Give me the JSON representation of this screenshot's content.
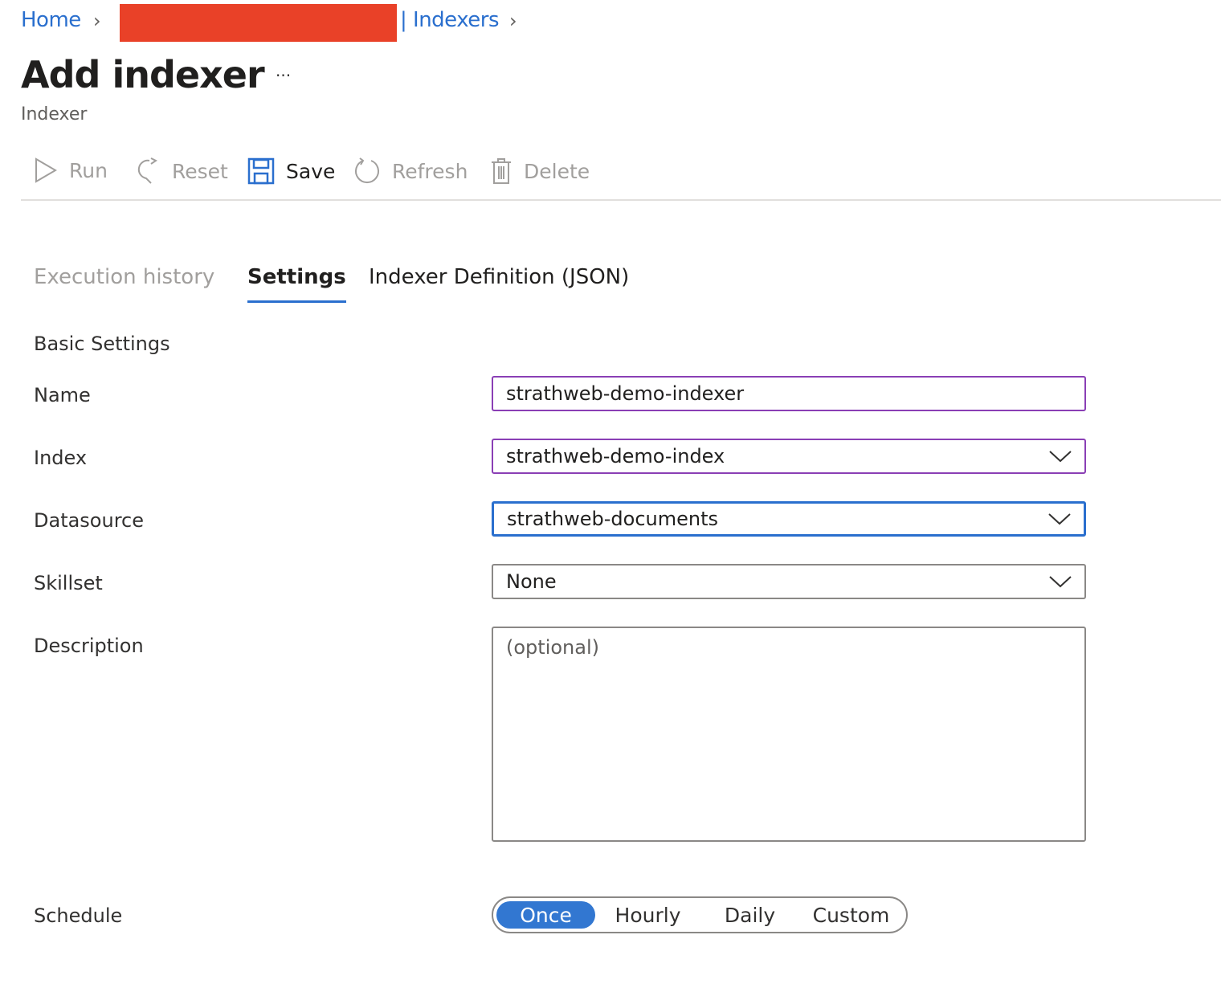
{
  "breadcrumb": {
    "home": "Home",
    "indexers": "| Indexers"
  },
  "header": {
    "title": "Add indexer",
    "more": "···",
    "subtitle": "Indexer"
  },
  "toolbar": {
    "run": "Run",
    "reset": "Reset",
    "save": "Save",
    "refresh": "Refresh",
    "delete": "Delete"
  },
  "tabs": [
    {
      "label": "Execution history"
    },
    {
      "label": "Settings",
      "selected": true
    },
    {
      "label": "Indexer Definition (JSON)"
    }
  ],
  "form": {
    "section": "Basic Settings",
    "name_label": "Name",
    "name_value": "strathweb-demo-indexer",
    "index_label": "Index",
    "index_value": "strathweb-demo-index",
    "datasource_label": "Datasource",
    "datasource_value": "strathweb-documents",
    "skillset_label": "Skillset",
    "skillset_value": "None",
    "description_label": "Description",
    "description_placeholder": "(optional)",
    "schedule_label": "Schedule",
    "schedule_options": [
      "Once",
      "Hourly",
      "Daily",
      "Custom"
    ],
    "schedule_selected": "Once"
  },
  "colors": {
    "accent": "#2a6fce",
    "redaction": "#e94128",
    "focus_purple": "#8a3fb5"
  }
}
